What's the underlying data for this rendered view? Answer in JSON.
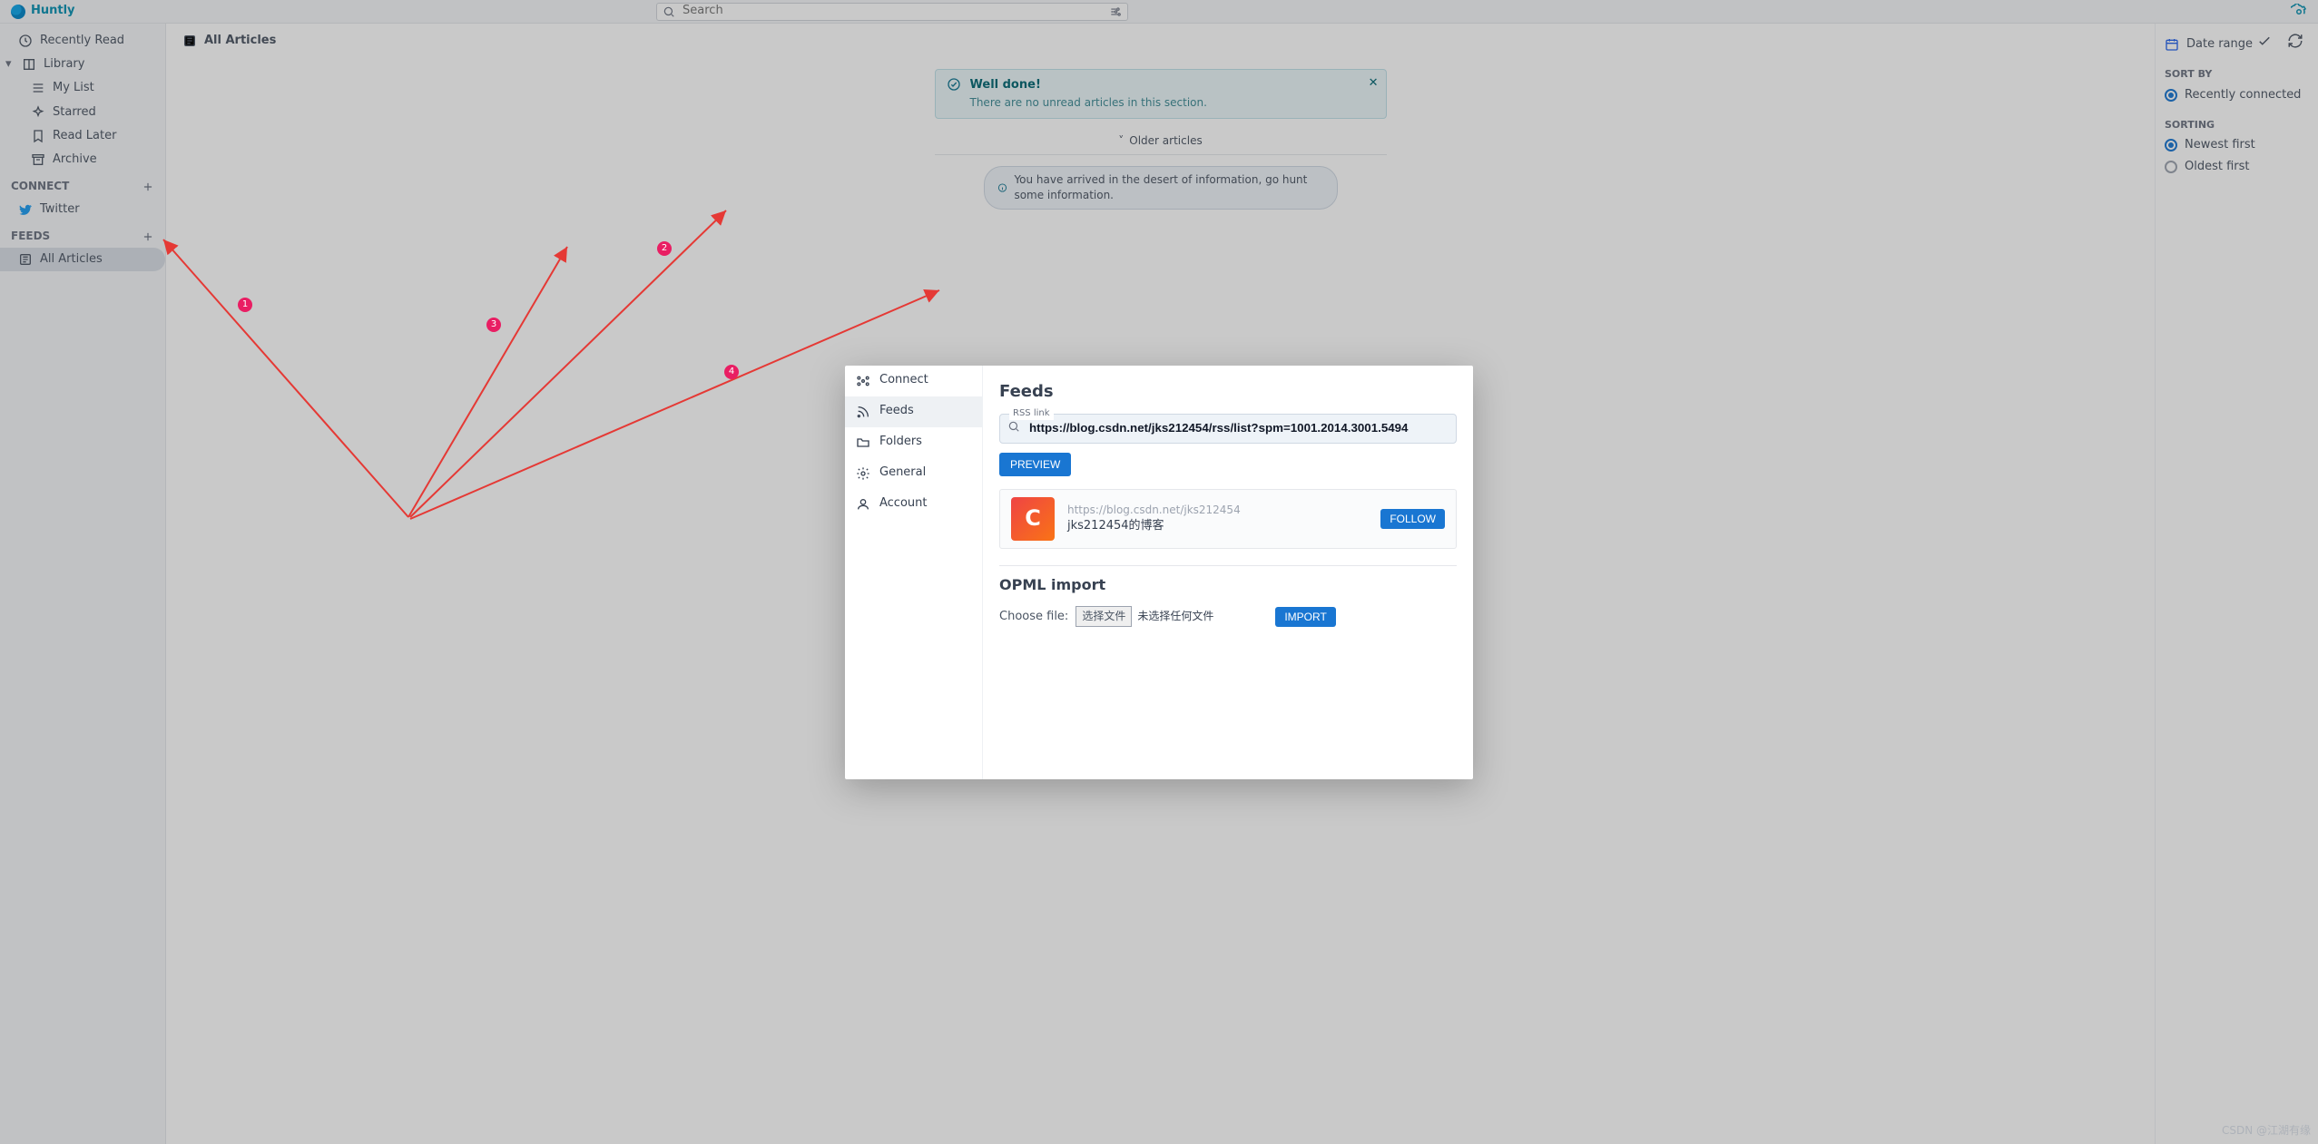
{
  "brand": {
    "name": "Huntly"
  },
  "search": {
    "placeholder": "Search"
  },
  "sidebar": {
    "recent": "Recently Read",
    "library": "Library",
    "mylist": "My List",
    "starred": "Starred",
    "readlater": "Read Later",
    "archive": "Archive",
    "connect": "CONNECT",
    "twitter": "Twitter",
    "feeds": "FEEDS",
    "allarticles": "All Articles"
  },
  "content": {
    "page_title": "All Articles",
    "alert_title": "Well done!",
    "alert_sub": "There are no unread articles in this section.",
    "older": "Older articles",
    "info": "You have arrived in the desert of information, go hunt some information."
  },
  "right": {
    "date_range": "Date range",
    "sort_by": "SORT BY",
    "recently_connected": "Recently connected",
    "sorting": "SORTING",
    "newest": "Newest first",
    "oldest": "Oldest first"
  },
  "modal": {
    "nav": {
      "connect": "Connect",
      "feeds": "Feeds",
      "folders": "Folders",
      "general": "General",
      "account": "Account"
    },
    "title": "Feeds",
    "rss_label": "RSS link",
    "rss_value": "https://blog.csdn.net/jks212454/rss/list?spm=1001.2014.3001.5494",
    "preview_btn": "PREVIEW",
    "card_url": "https://blog.csdn.net/jks212454",
    "card_title": "jks212454的博客",
    "follow_btn": "FOLLOW",
    "opml_title": "OPML import",
    "choose_file": "Choose file:",
    "pick": "选择文件",
    "nofile": "未选择任何文件",
    "import_btn": "IMPORT"
  },
  "pins": {
    "p1": "1",
    "p2": "2",
    "p3": "3",
    "p4": "4"
  },
  "watermark": "CSDN @江湖有缘"
}
